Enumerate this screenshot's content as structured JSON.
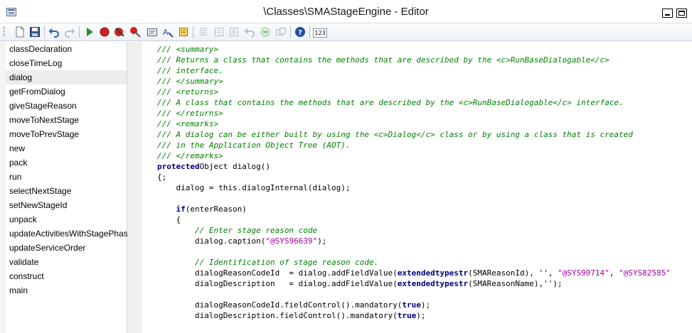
{
  "window": {
    "title": "\\Classes\\SMAStageEngine - Editor"
  },
  "toolbar": {
    "icons": [
      "new-icon",
      "save-icon",
      "undo-icon",
      "redo-icon",
      "run-icon",
      "breakpoint-icon",
      "remove-breakpoints-icon",
      "toggle-breakpoint-icon",
      "compile-icon",
      "lookup-icon",
      "script-icon",
      "list-icon",
      "list-more-icon",
      "properties-icon",
      "undo-grey-icon",
      "redo-grey-icon",
      "label-icon",
      "help-icon",
      "count-icon"
    ],
    "count_label": "123"
  },
  "methods": [
    {
      "label": "classDeclaration"
    },
    {
      "label": "closeTimeLog"
    },
    {
      "label": "dialog",
      "selected": true
    },
    {
      "label": "getFromDialog"
    },
    {
      "label": "giveStageReason"
    },
    {
      "label": "moveToNextStage"
    },
    {
      "label": "moveToPrevStage"
    },
    {
      "label": "new"
    },
    {
      "label": "pack"
    },
    {
      "label": "run"
    },
    {
      "label": "selectNextStage"
    },
    {
      "label": "setNewStageId"
    },
    {
      "label": "unpack"
    },
    {
      "label": "updateActivitiesWithStagePhase"
    },
    {
      "label": "updateServiceOrder"
    },
    {
      "label": "validate"
    },
    {
      "label": "construct"
    },
    {
      "label": "main"
    }
  ],
  "code": {
    "lines": [
      [
        [
          "cm",
          "/// <summary>"
        ]
      ],
      [
        [
          "cm",
          "/// Returns a class that contains the methods that are described by the <c>RunBaseDialogable</c>"
        ]
      ],
      [
        [
          "cm",
          "/// interface."
        ]
      ],
      [
        [
          "cm",
          "/// </summary>"
        ]
      ],
      [
        [
          "cm",
          "/// <returns>"
        ]
      ],
      [
        [
          "cm",
          "/// A class that contains the methods that are described by the <c>RunBaseDialogable</c> interface."
        ]
      ],
      [
        [
          "cm",
          "/// </returns>"
        ]
      ],
      [
        [
          "cm",
          "/// <remarks>"
        ]
      ],
      [
        [
          "cm",
          "/// A dialog can be either built by using the <c>Dialog</c> class or by using a class that is created"
        ]
      ],
      [
        [
          "cm",
          "/// in the Application Object Tree (AOT)."
        ]
      ],
      [
        [
          "cm",
          "/// </remarks>"
        ]
      ],
      [
        [
          "fn",
          "protected"
        ],
        [
          "",
          "Object dialog()"
        ]
      ],
      [
        [
          "",
          "{;"
        ]
      ],
      [
        [
          "",
          "    dialog = this.dialogInternal(dialog);"
        ]
      ],
      [
        [
          "",
          ""
        ]
      ],
      [
        [
          "",
          "    "
        ],
        [
          "fn",
          "if"
        ],
        [
          "",
          "(enterReason)"
        ]
      ],
      [
        [
          "",
          "    {"
        ]
      ],
      [
        [
          "",
          "        "
        ],
        [
          "cm",
          "// Enter stage reason code"
        ]
      ],
      [
        [
          "",
          "        dialog.caption("
        ],
        [
          "lbl",
          "\"@SYS96639\""
        ],
        [
          "",
          ");"
        ]
      ],
      [
        [
          "",
          ""
        ]
      ],
      [
        [
          "",
          "        "
        ],
        [
          "cm",
          "// Identification of stage reason code."
        ]
      ],
      [
        [
          "",
          "        dialogReasonCodeId  = dialog.addFieldValue("
        ],
        [
          "fn",
          "extendedtypestr"
        ],
        [
          "",
          "(SMAReasonId), '', "
        ],
        [
          "lbl",
          "\"@SYS90714\""
        ],
        [
          "",
          ", "
        ],
        [
          "lbl",
          "\"@SYS82585\""
        ]
      ],
      [
        [
          "",
          "        dialogDescription   = dialog.addFieldValue("
        ],
        [
          "fn",
          "extendedtypestr"
        ],
        [
          "",
          "(SMAReasonName),'');"
        ]
      ],
      [
        [
          "",
          ""
        ]
      ],
      [
        [
          "",
          "        dialogReasonCodeId.fieldControl().mandatory("
        ],
        [
          "fn",
          "true"
        ],
        [
          "",
          ");"
        ]
      ],
      [
        [
          "",
          "        dialogDescription.fieldControl().mandatory("
        ],
        [
          "fn",
          "true"
        ],
        [
          "",
          ");"
        ]
      ]
    ]
  },
  "colors": {
    "comment": "#008000",
    "keyword": "#000080",
    "label_string": "#a000a0",
    "selected_method_bg": "#ececec"
  }
}
